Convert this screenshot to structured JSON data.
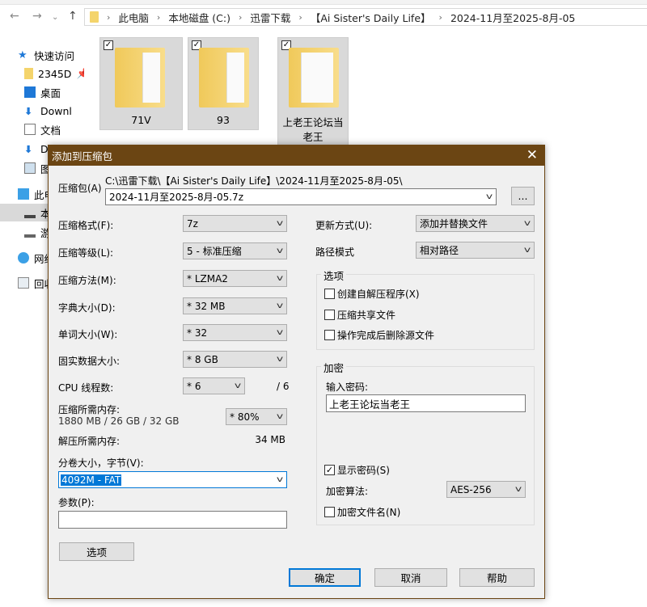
{
  "explorer": {
    "breadcrumb": [
      "此电脑",
      "本地磁盘 (C:)",
      "迅雷下载",
      "【Ai Sister's Daily Life】",
      "2024-11月至2025-8月-05"
    ],
    "sidebar": [
      {
        "label": "快速访问",
        "icon": "star-icon"
      },
      {
        "label": "2345D",
        "icon": "folder-icon"
      },
      {
        "label": "桌面",
        "icon": "desktop-icon"
      },
      {
        "label": "Downl",
        "icon": "download-icon"
      },
      {
        "label": "文档",
        "icon": "document-icon"
      },
      {
        "label": "D",
        "icon": "download-icon"
      },
      {
        "label": "图",
        "icon": "picture-icon"
      },
      {
        "label": "此电",
        "icon": "pc-icon"
      },
      {
        "label": "本",
        "icon": "drive-icon"
      },
      {
        "label": "游",
        "icon": "drive-icon"
      },
      {
        "label": "网络",
        "icon": "network-icon"
      },
      {
        "label": "回收",
        "icon": "recycle-bin-icon"
      }
    ],
    "folders": [
      {
        "name": "71V",
        "checked": true
      },
      {
        "name": "93",
        "checked": true
      },
      {
        "name": "上老王论坛当老王",
        "checked": true
      }
    ]
  },
  "dialog": {
    "title": "添加到压缩包",
    "archive_label": "压缩包(A)",
    "archive_path": "C:\\迅雷下载\\【Ai Sister's Daily Life】\\2024-11月至2025-8月-05\\",
    "archive_name": "2024-11月至2025-8月-05.7z",
    "browse_label": "...",
    "format_label": "压缩格式(F):",
    "format": "7z",
    "level_label": "压缩等级(L):",
    "level": "5 - 标准压缩",
    "method_label": "压缩方法(M):",
    "method": "* LZMA2",
    "dict_label": "字典大小(D):",
    "dict": "* 32 MB",
    "word_label": "单词大小(W):",
    "word": "* 32",
    "solid_label": "固实数据大小:",
    "solid": "* 8 GB",
    "cpu_label": "CPU 线程数:",
    "cpu": "* 6",
    "cpu_max": "/ 6",
    "mem_label": "压缩所需内存:",
    "mem_values": "1880 MB / 26 GB / 32 GB",
    "mem_pct": "* 80%",
    "dmem_label": "解压所需内存:",
    "dmem": "34 MB",
    "volume_label": "分卷大小，字节(V):",
    "volume": "4092M - FAT",
    "params_label": "参数(P):",
    "params": "",
    "options_button": "选项",
    "update_label": "更新方式(U):",
    "update": "添加并替换文件",
    "pathmode_label": "路径模式",
    "pathmode": "相对路径",
    "options_group": "选项",
    "options": [
      {
        "label": "创建自解压程序(X)",
        "checked": false
      },
      {
        "label": "压缩共享文件",
        "checked": false
      },
      {
        "label": "操作完成后删除源文件",
        "checked": false
      }
    ],
    "encrypt_group": "加密",
    "password_label": "输入密码:",
    "password": "上老王论坛当老王",
    "show_password": {
      "label": "显示密码(S)",
      "checked": true
    },
    "algo_label": "加密算法:",
    "algo": "AES-256",
    "encrypt_names": {
      "label": "加密文件名(N)",
      "checked": false
    },
    "ok": "确定",
    "cancel": "取消",
    "help": "帮助"
  },
  "colors": {
    "titlebar": "#6b4513",
    "accent": "#0078d7"
  }
}
